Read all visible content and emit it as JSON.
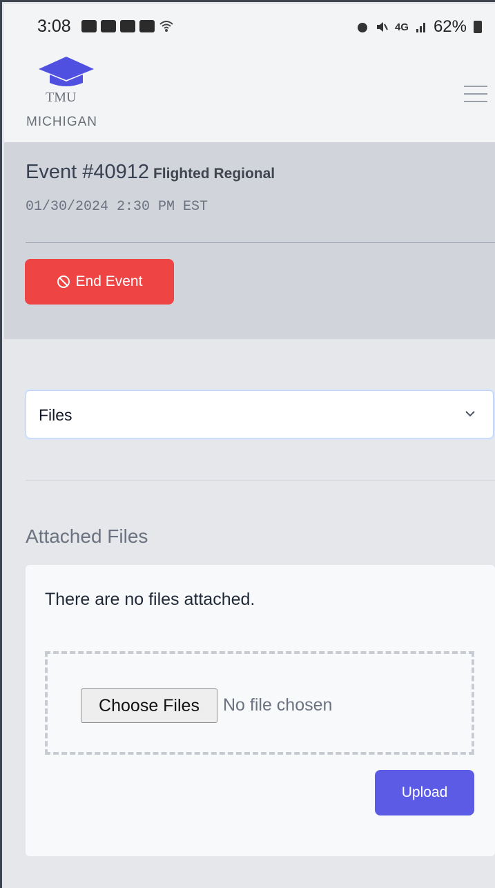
{
  "status_bar": {
    "time": "3:08",
    "network": "4G",
    "battery": "62%"
  },
  "header": {
    "logo_name": "TMU",
    "logo_state": "MICHIGAN",
    "menu_icon": "hamburger-icon"
  },
  "event": {
    "number": "Event #40912",
    "type": "Flighted Regional",
    "datetime": "01/30/2024 2:30 PM EST",
    "end_button_label": "End Event",
    "end_button_icon": "ban-icon"
  },
  "section_select": {
    "value": "Files",
    "icon": "chevron-down-icon"
  },
  "attached_files": {
    "title": "Attached Files",
    "empty_message": "There are no files attached.",
    "choose_button_label": "Choose Files",
    "file_status": "No file chosen",
    "upload_label": "Upload"
  },
  "colors": {
    "danger": "#ef4444",
    "primary": "#5b5be6",
    "logo": "#4f4fe0"
  }
}
